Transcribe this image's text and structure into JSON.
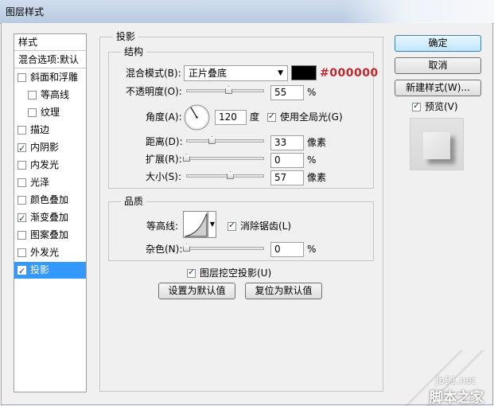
{
  "window": {
    "title": "图层样式"
  },
  "sidebar": {
    "header": "样式",
    "blend_options": "混合选项:默认",
    "items": [
      {
        "label": "斜面和浮雕",
        "checked": false,
        "indent": false,
        "active": false
      },
      {
        "label": "等高线",
        "checked": false,
        "indent": true,
        "active": false
      },
      {
        "label": "纹理",
        "checked": false,
        "indent": true,
        "active": false
      },
      {
        "label": "描边",
        "checked": false,
        "indent": false,
        "active": false
      },
      {
        "label": "内阴影",
        "checked": true,
        "indent": false,
        "active": false
      },
      {
        "label": "内发光",
        "checked": false,
        "indent": false,
        "active": false
      },
      {
        "label": "光泽",
        "checked": false,
        "indent": false,
        "active": false
      },
      {
        "label": "颜色叠加",
        "checked": false,
        "indent": false,
        "active": false
      },
      {
        "label": "渐变叠加",
        "checked": true,
        "indent": false,
        "active": false
      },
      {
        "label": "图案叠加",
        "checked": false,
        "indent": false,
        "active": false
      },
      {
        "label": "外发光",
        "checked": false,
        "indent": false,
        "active": false
      },
      {
        "label": "投影",
        "checked": true,
        "indent": false,
        "active": true
      }
    ]
  },
  "panel": {
    "title": "投影",
    "structure": {
      "title": "结构",
      "blend_mode_label": "混合模式(B):",
      "blend_mode_value": "正片叠底",
      "color_hex": "#000000",
      "opacity_label": "不透明度(O):",
      "opacity_value": "55",
      "opacity_unit": "%",
      "angle_label": "角度(A):",
      "angle_value": "120",
      "angle_unit": "度",
      "global_light_label": "使用全局光(G)",
      "global_light_checked": true,
      "distance_label": "距离(D):",
      "distance_value": "33",
      "distance_unit": "像素",
      "spread_label": "扩展(R):",
      "spread_value": "0",
      "spread_unit": "%",
      "size_label": "大小(S):",
      "size_value": "57",
      "size_unit": "像素"
    },
    "quality": {
      "title": "品质",
      "contour_label": "等高线:",
      "anti_alias_label": "消除锯齿(L)",
      "anti_alias_checked": true,
      "noise_label": "杂色(N):",
      "noise_value": "0",
      "noise_unit": "%"
    },
    "knockout_label": "图层挖空投影(U)",
    "knockout_checked": true,
    "set_default_label": "设置为默认值",
    "reset_default_label": "复位为默认值"
  },
  "buttons": {
    "ok": "确定",
    "cancel": "取消",
    "new_style": "新建样式(W)...",
    "preview_label": "预览(V)",
    "preview_checked": true
  },
  "watermark": {
    "line1": "jb51.net",
    "line2": "脚本之家"
  },
  "colors": {
    "accent": "#3399ff",
    "hex_text": "#c1272d",
    "swatch": "#000000"
  }
}
